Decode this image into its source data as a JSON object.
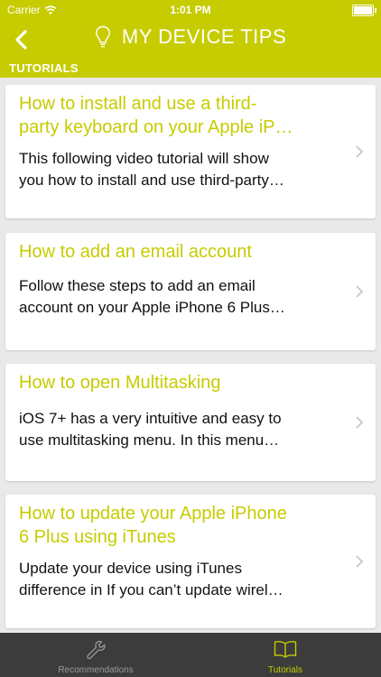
{
  "status": {
    "carrier": "Carrier",
    "time": "1:01 PM"
  },
  "header": {
    "title": "MY DEVICE TIPS"
  },
  "section": {
    "label": "TUTORIALS"
  },
  "cards": [
    {
      "title1": "How to install and use a third-",
      "title2": "party keyboard on your Apple iP…",
      "desc1": "This following video tutorial will show",
      "desc2": "you how to install and use third-party…"
    },
    {
      "title1": "How to add an email account",
      "desc1": "Follow these steps to add an email",
      "desc2": "account on your Apple iPhone 6 Plus…"
    },
    {
      "title1": "How to open Multitasking",
      "desc1": "iOS 7+ has a very intuitive and easy to",
      "desc2": "use multitasking menu. In this menu…"
    },
    {
      "title1": "How to update your Apple iPhone",
      "title2": "6 Plus using iTunes",
      "desc1": "Update your device using iTunes",
      "desc2": "difference in If you can’t update wirel…"
    }
  ],
  "tabs": [
    {
      "label": "Recommendations",
      "icon": "wrench-icon",
      "active": false
    },
    {
      "label": "Tutorials",
      "icon": "book-icon",
      "active": true
    }
  ],
  "colors": {
    "accent": "#c6cc00",
    "tabbar": "#3c3c3c",
    "inactive": "#9a9a9a",
    "background": "#e9e9e9"
  }
}
